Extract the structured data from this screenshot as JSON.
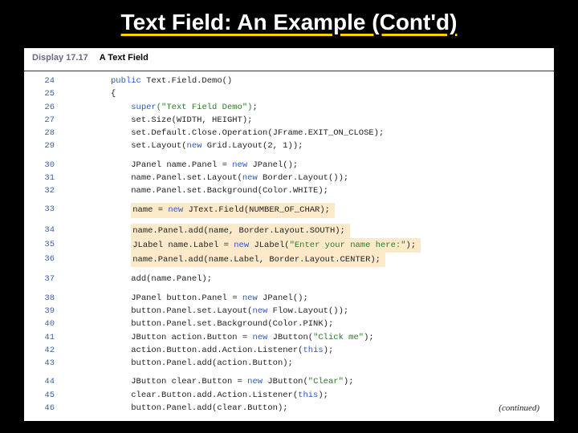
{
  "title": "Text Field: An Example (Cont'd)",
  "header": {
    "display_label": "Display 17.17",
    "caption": "A Text Field"
  },
  "code": {
    "l24": {
      "n": "24",
      "kw": "public",
      "rest": " Text.Field.Demo()"
    },
    "l25": {
      "n": "25",
      "rest": "{"
    },
    "l26": {
      "n": "26",
      "kw": "super",
      "str": "(\"Text Field Demo\")",
      "rest": ";"
    },
    "l27": {
      "n": "27",
      "rest": "set.Size(WIDTH, HEIGHT);"
    },
    "l28": {
      "n": "28",
      "rest": "set.Default.Close.Operation(JFrame.EXIT_ON_CLOSE);"
    },
    "l29": {
      "n": "29",
      "a": "set.Layout(",
      "kw": "new",
      "b": " Grid.Layout(2, 1));"
    },
    "l30": {
      "n": "30",
      "a": "JPanel name.Panel = ",
      "kw": "new",
      "b": " JPanel();"
    },
    "l31": {
      "n": "31",
      "a": "name.Panel.set.Layout(",
      "kw": "new",
      "b": " Border.Layout());"
    },
    "l32": {
      "n": "32",
      "rest": "name.Panel.set.Background(Color.WHITE);"
    },
    "l33": {
      "n": "33",
      "a": "name = ",
      "kw": "new",
      "b": " JText.Field(NUMBER_OF_CHAR);"
    },
    "l34": {
      "n": "34",
      "rest": "name.Panel.add(name, Border.Layout.SOUTH);"
    },
    "l35": {
      "n": "35",
      "a": "JLabel name.Label = ",
      "kw": "new",
      "b": " JLabel(",
      "str": "\"Enter your name here:\"",
      "c": ");"
    },
    "l36": {
      "n": "36",
      "rest": "name.Panel.add(name.Label, Border.Layout.CENTER);"
    },
    "l37": {
      "n": "37",
      "rest": "add(name.Panel);"
    },
    "l38": {
      "n": "38",
      "a": "JPanel button.Panel = ",
      "kw": "new",
      "b": " JPanel();"
    },
    "l39": {
      "n": "39",
      "a": "button.Panel.set.Layout(",
      "kw": "new",
      "b": " Flow.Layout());"
    },
    "l40": {
      "n": "40",
      "rest": "button.Panel.set.Background(Color.PINK);"
    },
    "l41": {
      "n": "41",
      "a": "JButton action.Button = ",
      "kw": "new",
      "b": " JButton(",
      "str": "\"Click me\"",
      "c": ");"
    },
    "l42": {
      "n": "42",
      "a": "action.Button.add.Action.Listener(",
      "kw": "this",
      "b": ");"
    },
    "l43": {
      "n": "43",
      "rest": "button.Panel.add(action.Button);"
    },
    "l44": {
      "n": "44",
      "a": "JButton clear.Button = ",
      "kw": "new",
      "b": " JButton(",
      "str": "\"Clear\"",
      "c": ");"
    },
    "l45": {
      "n": "45",
      "a": "clear.Button.add.Action.Listener(",
      "kw": "this",
      "b": ");"
    },
    "l46": {
      "n": "46",
      "rest": "button.Panel.add(clear.Button);"
    }
  },
  "continued": "(continued)"
}
